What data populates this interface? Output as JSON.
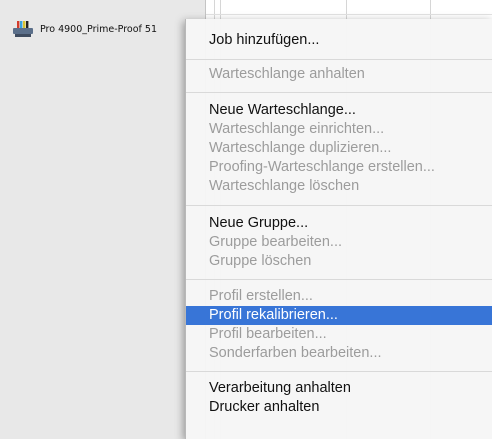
{
  "sidebar": {
    "printer_name": "Pro 4900_Prime-Proof 51"
  },
  "menu": {
    "items": [
      {
        "label": "Job hinzufügen...",
        "state": "enabled"
      },
      {
        "label": "Warteschlange anhalten",
        "state": "disabled"
      },
      {
        "label": "Neue Warteschlange...",
        "state": "enabled"
      },
      {
        "label": "Warteschlange einrichten...",
        "state": "disabled"
      },
      {
        "label": "Warteschlange duplizieren...",
        "state": "disabled"
      },
      {
        "label": "Proofing-Warteschlange erstellen...",
        "state": "disabled"
      },
      {
        "label": "Warteschlange löschen",
        "state": "disabled"
      },
      {
        "label": "Neue Gruppe...",
        "state": "enabled"
      },
      {
        "label": "Gruppe bearbeiten...",
        "state": "disabled"
      },
      {
        "label": "Gruppe löschen",
        "state": "disabled"
      },
      {
        "label": "Profil erstellen...",
        "state": "disabled"
      },
      {
        "label": "Profil rekalibrieren...",
        "state": "highlighted"
      },
      {
        "label": "Profil bearbeiten...",
        "state": "disabled"
      },
      {
        "label": "Sonderfarben bearbeiten...",
        "state": "disabled"
      },
      {
        "label": "Verarbeitung anhalten",
        "state": "enabled"
      },
      {
        "label": "Drucker anhalten",
        "state": "enabled"
      }
    ]
  },
  "colors": {
    "highlight": "#3875d7",
    "disabled_text": "#9c9c9c",
    "enabled_text": "#111111"
  },
  "icons": {
    "printer": "printer-icon"
  }
}
